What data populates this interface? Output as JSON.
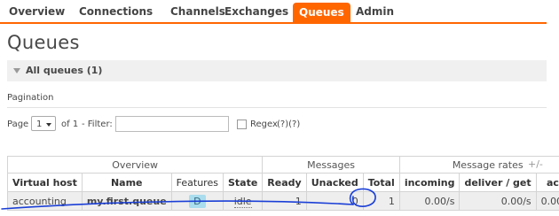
{
  "nav": {
    "tabs": [
      {
        "label": "Overview"
      },
      {
        "label": "Connections"
      },
      {
        "label": "Channels"
      },
      {
        "label": "Exchanges"
      },
      {
        "label": "Queues",
        "active": true
      },
      {
        "label": "Admin"
      }
    ]
  },
  "page": {
    "title": "Queues",
    "section": "All queues (1)"
  },
  "pagination": {
    "label": "Pagination",
    "page_label": "Page",
    "page_value": "1",
    "of_label": "of 1",
    "filter_label": "- Filter:",
    "filter_value": "",
    "regex_label": "Regex",
    "regex_hint": "(?)(?)"
  },
  "table": {
    "groups": {
      "overview": "Overview",
      "messages": "Messages",
      "rates": "Message rates",
      "plusminus": "+/-"
    },
    "columns": {
      "vhost": "Virtual host",
      "name": "Name",
      "features": "Features",
      "state": "State",
      "ready": "Ready",
      "unacked": "Unacked",
      "total": "Total",
      "incoming": "incoming",
      "deliver": "deliver / get",
      "ack": "ack"
    },
    "rows": [
      {
        "vhost": "accounting",
        "name": "my.first.queue",
        "features": "D",
        "state": "idle",
        "ready": "1",
        "unacked": "0",
        "total": "1",
        "incoming": "0.00/s",
        "deliver": "0.00/s",
        "ack": "0.00/s"
      }
    ]
  },
  "colors": {
    "accent": "#ff6600",
    "annotation_ink": "#1a3fd6"
  }
}
